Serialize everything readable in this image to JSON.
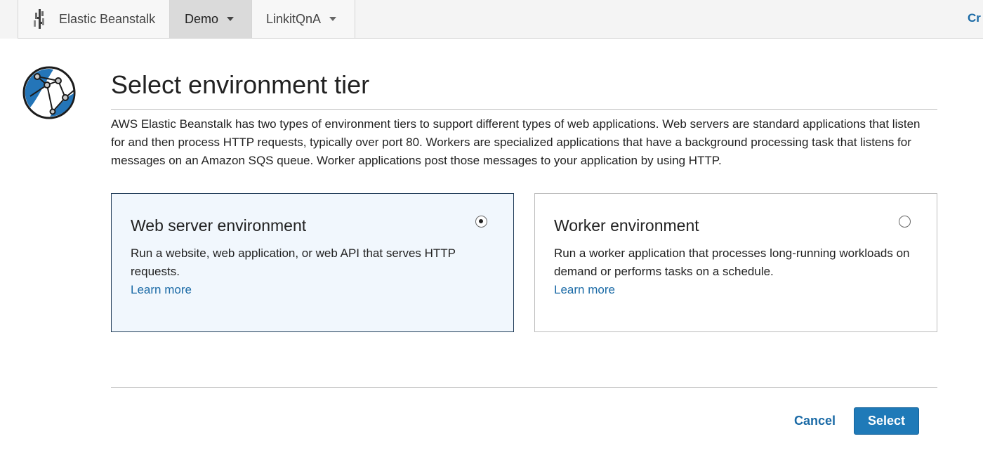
{
  "topbar": {
    "app_name": "Elastic Beanstalk",
    "app_icon": "elastic-beanstalk-logo",
    "breadcrumbs": [
      {
        "label": "Demo",
        "active": true,
        "has_dropdown": true
      },
      {
        "label": "LinkitQnA",
        "active": false,
        "has_dropdown": true
      }
    ],
    "right_link": "Cr"
  },
  "page": {
    "icon": "globe-icon",
    "title": "Select environment tier",
    "description": "AWS Elastic Beanstalk has two types of environment tiers to support different types of web applications. Web servers are standard applications that listen for and then process HTTP requests, typically over port 80. Workers are specialized applications that have a background processing task that listens for messages on an Amazon SQS queue. Worker applications post those messages to your application by using HTTP."
  },
  "tiers": [
    {
      "title": "Web server environment",
      "description": "Run a website, web application, or web API that serves HTTP requests.",
      "learn_more": "Learn more",
      "selected": true
    },
    {
      "title": "Worker environment",
      "description": "Run a worker application that processes long-running workloads on demand or performs tasks on a schedule.",
      "learn_more": "Learn more",
      "selected": false
    }
  ],
  "footer": {
    "cancel_label": "Cancel",
    "select_label": "Select"
  },
  "colors": {
    "link": "#1a6aa6",
    "primary_button": "#1f7ab8",
    "selected_card_bg": "#f1f7fd",
    "selected_card_border": "#1f3b57"
  }
}
